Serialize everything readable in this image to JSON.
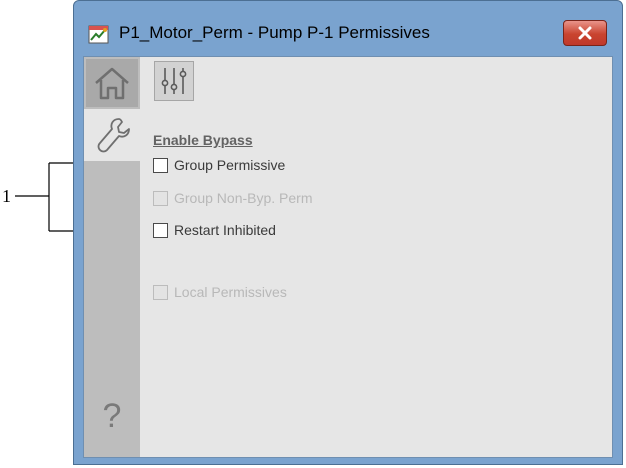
{
  "callout": {
    "number": "1"
  },
  "window": {
    "title": "P1_Motor_Perm - Pump P-1 Permissives",
    "close_icon": "close-icon"
  },
  "sidebar": {
    "tabs": [
      {
        "name": "home",
        "icon": "home-icon",
        "selected": false
      },
      {
        "name": "maintenance",
        "icon": "wrench-icon",
        "selected": true
      }
    ],
    "help_label": "?"
  },
  "toolbar": {
    "settings_icon": "sliders-icon"
  },
  "enable_bypass": {
    "title": "Enable Bypass",
    "items": [
      {
        "label": "Group Permissive",
        "checked": false,
        "enabled": true
      },
      {
        "label": "Group Non-Byp. Perm",
        "checked": false,
        "enabled": false
      },
      {
        "label": "Restart Inhibited",
        "checked": false,
        "enabled": true
      }
    ]
  },
  "local_permissives": {
    "label": "Local Permissives",
    "checked": false,
    "enabled": false
  },
  "colors": {
    "titlebar": "#7aa3cf",
    "close": "#c9442f",
    "client": "#e6e6e6",
    "sidebar": "#bdbdbd"
  }
}
